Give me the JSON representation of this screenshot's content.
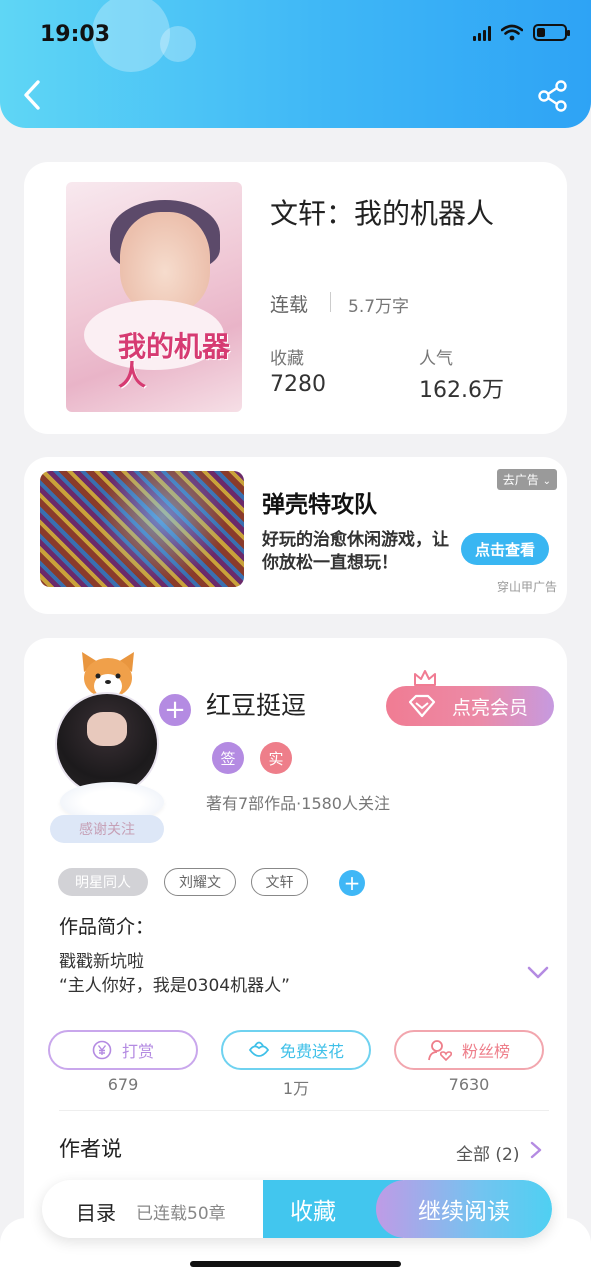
{
  "status_bar": {
    "time": "19:03"
  },
  "book": {
    "title": "文轩：我的机器人",
    "cover_title": "我的机器人",
    "status": "连载",
    "word_count": "5.7万字",
    "favorites_label": "收藏",
    "favorites_value": "7280",
    "popularity_label": "人气",
    "popularity_value": "162.6万"
  },
  "ad": {
    "title": "弹壳特攻队",
    "description": "好玩的治愈休闲游戏，让你放松一直想玩！",
    "tag": "去广告",
    "cta": "点击查看",
    "source": "穿山甲广告"
  },
  "author": {
    "name": "红豆挺逗",
    "thanks_label": "感谢关注",
    "vip_label": "点亮会员",
    "badges": [
      "签",
      "实"
    ],
    "stats": "著有7部作品·1580人关注"
  },
  "tags": [
    "明星同人",
    "刘耀文",
    "文轩"
  ],
  "intro": {
    "label": "作品简介：",
    "text": "戳戳新坑啦\n“主人你好，我是0304机器人”"
  },
  "actions": [
    {
      "label": "打赏",
      "count": "679",
      "color": "#b48be2"
    },
    {
      "label": "免费送花",
      "count": "1万",
      "color": "#3fc0e8"
    },
    {
      "label": "粉丝榜",
      "count": "7630",
      "color": "#ee7e8a"
    }
  ],
  "author_says": {
    "label": "作者说",
    "all_label": "全部 (2)"
  },
  "bottom_bar": {
    "toc_label": "目录",
    "chapters_label": "已连载50章",
    "favorite_label": "收藏",
    "read_label": "继续阅读"
  }
}
